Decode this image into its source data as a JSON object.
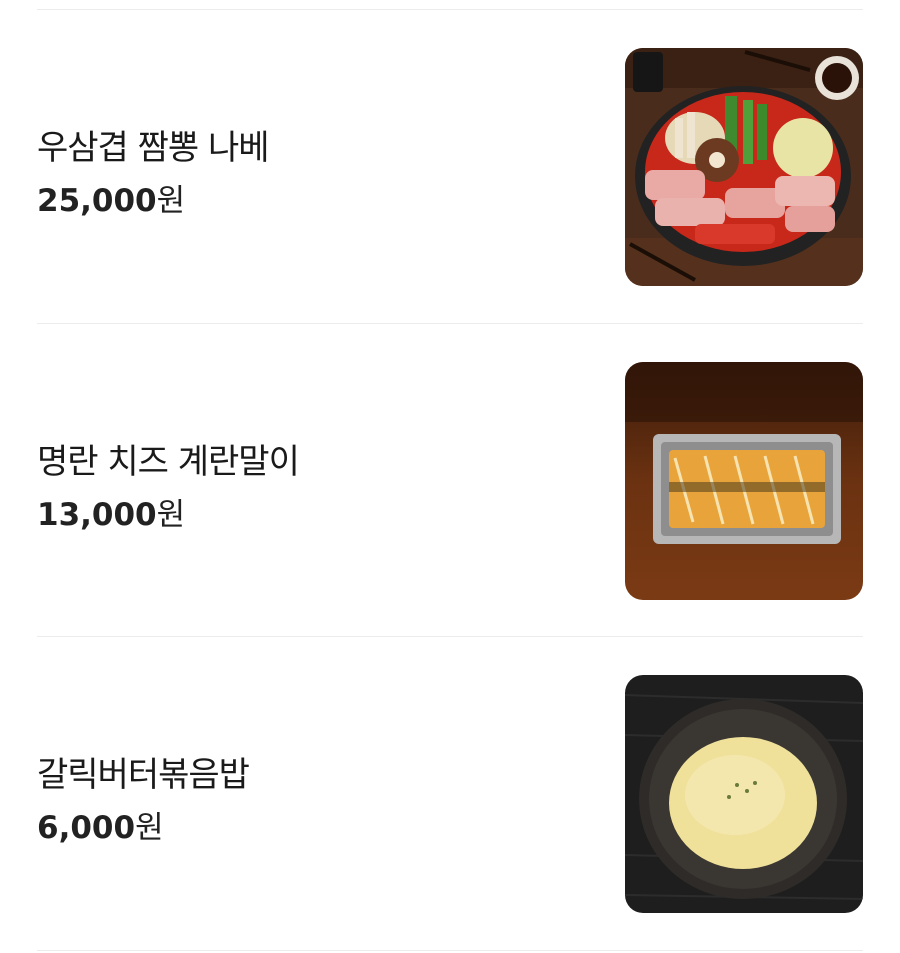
{
  "menu": {
    "items": [
      {
        "name": "우삼겹 짬뽕 나베",
        "price": "25,000",
        "currency": "원",
        "image": "nabe-hotpot-photo"
      },
      {
        "name": "명란 치즈 계란말이",
        "price": "13,000",
        "currency": "원",
        "image": "rolled-omelette-photo"
      },
      {
        "name": "갈릭버터볶음밥",
        "price": "6,000",
        "currency": "원",
        "image": "garlic-butter-fried-rice-photo"
      }
    ]
  }
}
